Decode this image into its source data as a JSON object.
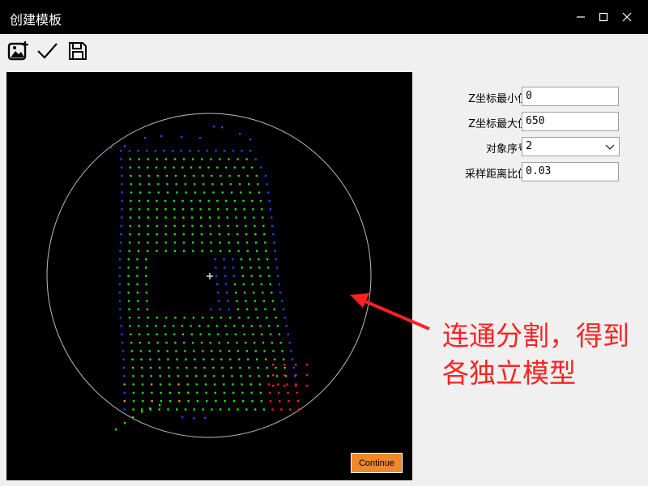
{
  "window": {
    "title": "创建模板",
    "minimize_symbol": "—",
    "maximize_symbol": "☐",
    "close_symbol": "✕"
  },
  "toolbar": {
    "buttons": [
      {
        "icon": "add-image-icon"
      },
      {
        "icon": "checkmark-icon"
      },
      {
        "icon": "save-icon"
      }
    ]
  },
  "viewport": {
    "continue_label": "Continue",
    "background": "#000000",
    "circle_color": "#bdbdbd"
  },
  "params": {
    "z_min": {
      "label": "Z坐标最小值",
      "value": "0"
    },
    "z_max": {
      "label": "Z坐标最大值",
      "value": "650"
    },
    "object_index": {
      "label": "对象序号",
      "value": "2"
    },
    "sample_ratio": {
      "label": "采样距离比值",
      "value": "0.03"
    }
  },
  "annotation": {
    "line1": "连通分割，得到",
    "line2": "各独立模型",
    "color": "#ff2222"
  },
  "colors": {
    "accent": "#f0872a",
    "point_green": "#22dd22",
    "point_blue": "#2244ee",
    "point_red": "#ee2222",
    "point_orange": "#dd9922"
  }
}
